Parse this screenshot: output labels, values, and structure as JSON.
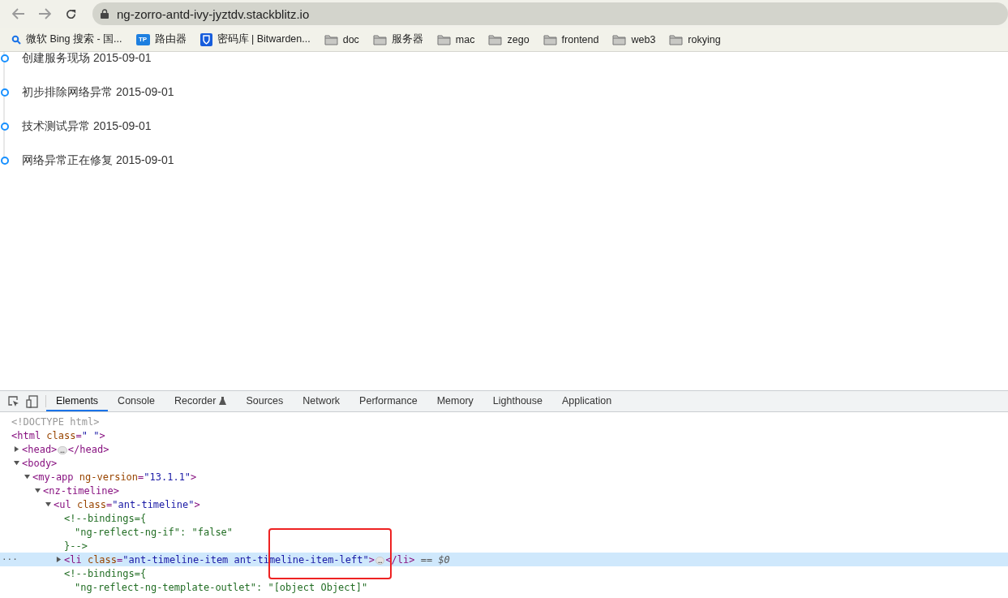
{
  "browser": {
    "url": "ng-zorro-antd-ivy-jyztdv.stackblitz.io",
    "bookmarks": [
      {
        "kind": "search",
        "label": "微软 Bing 搜索 - 国..."
      },
      {
        "kind": "tp",
        "label": "路由器",
        "icon_text": "TP"
      },
      {
        "kind": "shield",
        "label": "密码库 | Bitwarden..."
      },
      {
        "kind": "folder",
        "label": "doc"
      },
      {
        "kind": "folder",
        "label": "服务器"
      },
      {
        "kind": "folder",
        "label": "mac"
      },
      {
        "kind": "folder",
        "label": "zego"
      },
      {
        "kind": "folder",
        "label": "frontend"
      },
      {
        "kind": "folder",
        "label": "web3"
      },
      {
        "kind": "folder",
        "label": "rokying"
      }
    ]
  },
  "timeline": [
    {
      "text": "创建服务现场 2015-09-01"
    },
    {
      "text": "初步排除网络异常 2015-09-01"
    },
    {
      "text": "技术测试异常 2015-09-01"
    },
    {
      "text": "网络异常正在修复 2015-09-01"
    }
  ],
  "devtools": {
    "tabs": [
      {
        "label": "Elements",
        "selected": true
      },
      {
        "label": "Console",
        "selected": false
      },
      {
        "label": "Recorder",
        "selected": false,
        "flask": true
      },
      {
        "label": "Sources",
        "selected": false
      },
      {
        "label": "Network",
        "selected": false
      },
      {
        "label": "Performance",
        "selected": false
      },
      {
        "label": "Memory",
        "selected": false
      },
      {
        "label": "Lighthouse",
        "selected": false
      },
      {
        "label": "Application",
        "selected": false
      }
    ],
    "dom_tree": [
      {
        "selected": false,
        "tokens": [
          {
            "kind": "doctype",
            "text": "<!DOCTYPE html>"
          }
        ]
      },
      {
        "selected": false,
        "tokens": [
          {
            "kind": "tag",
            "text": "<html"
          },
          {
            "kind": "attr",
            "text": " class"
          },
          {
            "kind": "tag",
            "text": "="
          },
          {
            "kind": "value",
            "text": "\" \""
          },
          {
            "kind": "tag",
            "text": ">"
          }
        ],
        "children": [
          {
            "selected": false,
            "expanded": false,
            "tokens": [
              {
                "kind": "tag",
                "text": "<head>"
              },
              {
                "kind": "ellipsis",
                "text": "…"
              },
              {
                "kind": "tag",
                "text": "</head>"
              }
            ]
          },
          {
            "selected": false,
            "expanded": true,
            "tokens": [
              {
                "kind": "tag",
                "text": "<body>"
              }
            ],
            "children": [
              {
                "selected": false,
                "expanded": true,
                "tokens": [
                  {
                    "kind": "tag",
                    "text": "<my-app"
                  },
                  {
                    "kind": "attr",
                    "text": " ng-version"
                  },
                  {
                    "kind": "tag",
                    "text": "="
                  },
                  {
                    "kind": "value",
                    "text": "\"13.1.1\""
                  },
                  {
                    "kind": "tag",
                    "text": ">"
                  }
                ],
                "children": [
                  {
                    "selected": false,
                    "expanded": true,
                    "tokens": [
                      {
                        "kind": "tag",
                        "text": "<nz-timeline>"
                      }
                    ],
                    "children": [
                      {
                        "selected": false,
                        "expanded": true,
                        "tokens": [
                          {
                            "kind": "tag",
                            "text": "<ul"
                          },
                          {
                            "kind": "attr",
                            "text": " class"
                          },
                          {
                            "kind": "tag",
                            "text": "="
                          },
                          {
                            "kind": "value",
                            "text": "\"ant-timeline\""
                          },
                          {
                            "kind": "tag",
                            "text": ">"
                          }
                        ],
                        "children": [
                          {
                            "selected": false,
                            "tokens": [
                              {
                                "kind": "comment",
                                "text": "<!--bindings={"
                              }
                            ],
                            "children": [
                              {
                                "selected": false,
                                "tokens": [
                                  {
                                    "kind": "comment",
                                    "text": "\"ng-reflect-ng-if\": \"false\""
                                  }
                                ]
                              }
                            ],
                            "closing": "}-->"
                          },
                          {
                            "selected": true,
                            "gutter": "···",
                            "expanded": false,
                            "tokens": [
                              {
                                "kind": "tag",
                                "text": "<li"
                              },
                              {
                                "kind": "attr",
                                "text": " class"
                              },
                              {
                                "kind": "tag",
                                "text": "="
                              },
                              {
                                "kind": "value",
                                "text": "\"ant-timeline-item ant-timeline-item-left\""
                              },
                              {
                                "kind": "tag",
                                "text": ">"
                              },
                              {
                                "kind": "ellipsis",
                                "text": "…"
                              },
                              {
                                "kind": "tag",
                                "text": "</li>"
                              },
                              {
                                "kind": "marker",
                                "text": " == $0"
                              }
                            ]
                          },
                          {
                            "selected": false,
                            "tokens": [
                              {
                                "kind": "comment",
                                "text": "<!--bindings={"
                              }
                            ],
                            "children": [
                              {
                                "selected": false,
                                "tokens": [
                                  {
                                    "kind": "comment",
                                    "text": "\"ng-reflect-ng-template-outlet\": \"[object Object]\""
                                  }
                                ]
                              }
                            ]
                          }
                        ]
                      }
                    ]
                  }
                ]
              }
            ]
          }
        ]
      }
    ]
  }
}
